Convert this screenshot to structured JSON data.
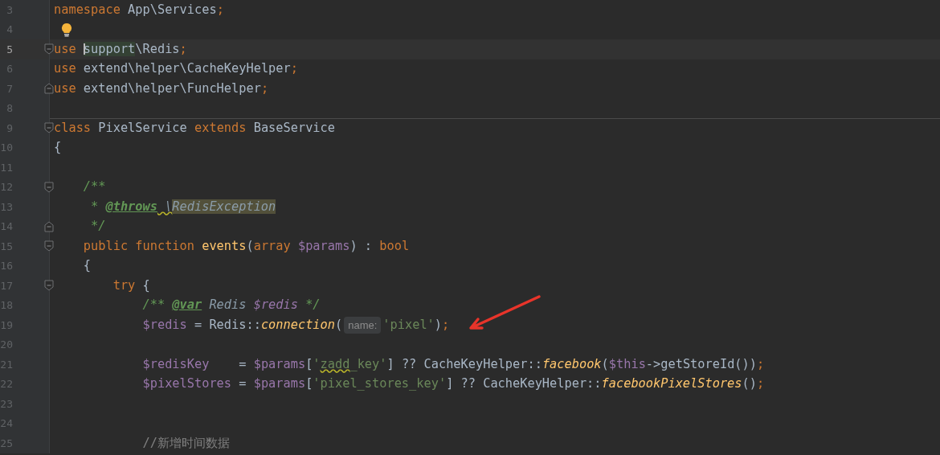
{
  "editor": {
    "lines": [
      {
        "number": "3",
        "tokens": [
          {
            "text": "namespace",
            "kind": "keyword"
          },
          {
            "text": " App\\Services",
            "kind": "plain"
          },
          {
            "text": ";",
            "kind": "keyword"
          }
        ]
      },
      {
        "number": "4",
        "intention": true
      },
      {
        "number": "5",
        "current": true,
        "fold_start": true,
        "tokens": [
          {
            "text": "use ",
            "kind": "keyword"
          },
          {
            "text": "support",
            "kind": "plain",
            "usage_highlight": true,
            "caret": true
          },
          {
            "text": "\\Redis",
            "kind": "plain"
          },
          {
            "text": ";",
            "kind": "keyword"
          }
        ]
      },
      {
        "number": "6",
        "tokens": [
          {
            "text": "use",
            "kind": "keyword"
          },
          {
            "text": " extend\\helper\\CacheKeyHelper",
            "kind": "plain"
          },
          {
            "text": ";",
            "kind": "keyword"
          }
        ]
      },
      {
        "number": "7",
        "fold_end": true,
        "tokens": [
          {
            "text": "use",
            "kind": "keyword"
          },
          {
            "text": " extend\\helper\\FuncHelper",
            "kind": "plain"
          },
          {
            "text": ";",
            "kind": "keyword"
          }
        ]
      },
      {
        "number": "8"
      },
      {
        "number": "9",
        "separator": true,
        "fold_start": true,
        "tokens": [
          {
            "text": "class",
            "kind": "keyword"
          },
          {
            "text": " PixelService ",
            "kind": "plain"
          },
          {
            "text": "extends",
            "kind": "keyword"
          },
          {
            "text": " BaseService",
            "kind": "plain"
          }
        ]
      },
      {
        "number": "10",
        "tokens": [
          {
            "text": "{",
            "kind": "plain"
          }
        ]
      },
      {
        "number": "11"
      },
      {
        "number": "12",
        "fold_start": true,
        "tokens": [
          {
            "text": "    /**",
            "kind": "doc"
          }
        ]
      },
      {
        "number": "13",
        "tokens": [
          {
            "text": "     * ",
            "kind": "doc"
          },
          {
            "text": "@throws",
            "kind": "doctag"
          },
          {
            "text": " \\",
            "kind": "docitalic",
            "warning": true
          },
          {
            "text": "RedisException",
            "kind": "docitalic",
            "text_highlight": true
          }
        ]
      },
      {
        "number": "14",
        "fold_end": true,
        "tokens": [
          {
            "text": "     */",
            "kind": "doc"
          }
        ]
      },
      {
        "number": "15",
        "fold_start": true,
        "tokens": [
          {
            "text": "    public function ",
            "kind": "keyword"
          },
          {
            "text": "events",
            "kind": "function"
          },
          {
            "text": "(",
            "kind": "plain"
          },
          {
            "text": "array ",
            "kind": "keyword"
          },
          {
            "text": "$params",
            "kind": "variable"
          },
          {
            "text": ") : ",
            "kind": "plain"
          },
          {
            "text": "bool",
            "kind": "keyword"
          }
        ]
      },
      {
        "number": "16",
        "tokens": [
          {
            "text": "    {",
            "kind": "plain"
          }
        ]
      },
      {
        "number": "17",
        "fold_start": true,
        "tokens": [
          {
            "text": "        try ",
            "kind": "keyword"
          },
          {
            "text": "{",
            "kind": "plain"
          }
        ]
      },
      {
        "number": "18",
        "tokens": [
          {
            "text": "            /** ",
            "kind": "doc"
          },
          {
            "text": "@var",
            "kind": "doctag"
          },
          {
            "text": " Redis ",
            "kind": "docitalic"
          },
          {
            "text": "$redis",
            "kind": "docvariable"
          },
          {
            "text": " */",
            "kind": "doc"
          }
        ]
      },
      {
        "number": "19",
        "tokens": [
          {
            "text": "            $redis",
            "kind": "variable"
          },
          {
            "text": " = Redis::",
            "kind": "plain"
          },
          {
            "text": "connection",
            "kind": "call"
          },
          {
            "text": "(",
            "kind": "plain"
          },
          {
            "text": "name:",
            "kind": "hint"
          },
          {
            "text": "'pixel'",
            "kind": "string"
          },
          {
            "text": ")",
            "kind": "plain"
          },
          {
            "text": ";",
            "kind": "keyword"
          }
        ]
      },
      {
        "number": "20"
      },
      {
        "number": "21",
        "tokens": [
          {
            "text": "            $redisKey",
            "kind": "variable"
          },
          {
            "text": "    = ",
            "kind": "plain"
          },
          {
            "text": "$params",
            "kind": "variable"
          },
          {
            "text": "[",
            "kind": "plain"
          },
          {
            "text": "'",
            "kind": "string"
          },
          {
            "text": "zadd",
            "kind": "string",
            "warning": true
          },
          {
            "text": "_key'",
            "kind": "string"
          },
          {
            "text": "] ?? CacheKeyHelper::",
            "kind": "plain"
          },
          {
            "text": "facebook",
            "kind": "call"
          },
          {
            "text": "(",
            "kind": "plain"
          },
          {
            "text": "$this",
            "kind": "variable"
          },
          {
            "text": "->getStoreId())",
            "kind": "plain"
          },
          {
            "text": ";",
            "kind": "keyword"
          }
        ]
      },
      {
        "number": "22",
        "tokens": [
          {
            "text": "            $pixelStores",
            "kind": "variable"
          },
          {
            "text": " = ",
            "kind": "plain"
          },
          {
            "text": "$params",
            "kind": "variable"
          },
          {
            "text": "[",
            "kind": "plain"
          },
          {
            "text": "'pixel_stores_key'",
            "kind": "string"
          },
          {
            "text": "] ?? CacheKeyHelper::",
            "kind": "plain"
          },
          {
            "text": "facebookPixelStores",
            "kind": "call"
          },
          {
            "text": "()",
            "kind": "plain"
          },
          {
            "text": ";",
            "kind": "keyword"
          }
        ]
      },
      {
        "number": "23"
      },
      {
        "number": "24"
      },
      {
        "number": "25",
        "tokens": [
          {
            "text": "            //新增时间数据",
            "kind": "comment"
          }
        ]
      }
    ]
  }
}
